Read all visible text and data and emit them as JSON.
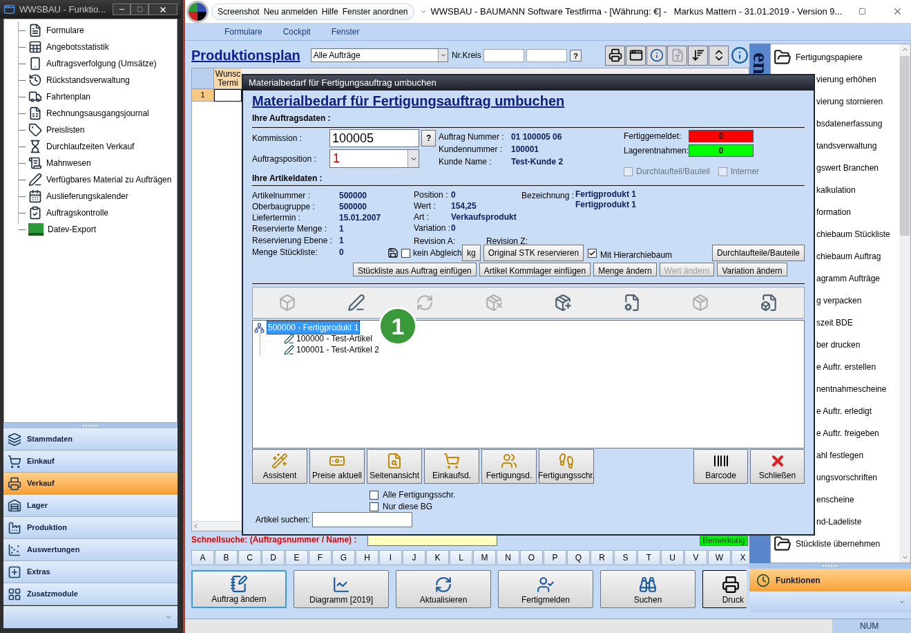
{
  "left_window": {
    "title": "WWSBAU - Funktio...",
    "tree": [
      {
        "label": "Formulare"
      },
      {
        "label": "Angebotsstatistik"
      },
      {
        "label": "Auftragsverfolgung (Umsätze)"
      },
      {
        "label": "Rückstandsverwaltung"
      },
      {
        "label": "Fahrtenplan"
      },
      {
        "label": "Rechnungsausgangsjournal"
      },
      {
        "label": "Preislisten"
      },
      {
        "label": "Durchlaufzeiten Verkauf"
      },
      {
        "label": "Mahnwesen"
      },
      {
        "label": "Verfügbares Material zu Aufträgen"
      },
      {
        "label": "Auslieferungskalender"
      },
      {
        "label": "Auftragskontrolle"
      },
      {
        "label": "Datev-Export"
      }
    ],
    "nav": [
      {
        "label": "Stammdaten",
        "selected": false
      },
      {
        "label": "Einkauf",
        "selected": false
      },
      {
        "label": "Verkauf",
        "selected": true
      },
      {
        "label": "Lager",
        "selected": false
      },
      {
        "label": "Produktion",
        "selected": false
      },
      {
        "label": "Auswertungen",
        "selected": false
      },
      {
        "label": "Extras",
        "selected": false
      },
      {
        "label": "Zusatzmodule",
        "selected": false
      }
    ]
  },
  "main_window": {
    "quick_menu": [
      "Screenshot",
      "Neu anmelden",
      "Hilfe",
      "Fenster anordnen"
    ],
    "title": "WWSBAU - BAUMANN Software Testfirma - [Währung: €] -   Markus Mattern - 31.01.2019 - Version 9...",
    "menu": [
      "Formulare",
      "Cockpit",
      "Fenster"
    ]
  },
  "plan": {
    "title": "Produktionsplan",
    "filter": "Alle Aufträge",
    "nr_kreis_label": "Nr.Kreis",
    "help": "?",
    "columns": [
      "Wunsc\nTermi"
    ],
    "rows": [
      {
        "number": "1",
        "selected": true
      }
    ],
    "quick_search_label": "Schnellsuche: (Auftragsnummer / Name) :",
    "remark": "Bemerkung",
    "letters": [
      "A",
      "B",
      "C",
      "D",
      "E",
      "F",
      "G",
      "H",
      "I",
      "J",
      "K",
      "L",
      "M",
      "N",
      "O",
      "P",
      "Q",
      "R",
      "S",
      "T",
      "U",
      "V",
      "W",
      "X"
    ],
    "actions": [
      {
        "label": "Auftrag ändern",
        "selected": true,
        "kind": "full"
      },
      {
        "label": "Diagramm [2019]",
        "selected": false,
        "kind": "full"
      },
      {
        "label": "Aktualisieren",
        "selected": false,
        "kind": "full"
      },
      {
        "label": "Fertigmelden",
        "selected": false,
        "kind": "full"
      },
      {
        "label": "Suchen",
        "selected": false,
        "kind": "full"
      },
      {
        "label": "Druck",
        "selected": false,
        "kind": "partial"
      }
    ]
  },
  "right_panel": {
    "caption": "en",
    "footer": "Funktionen",
    "items": [
      {
        "label": "Fertigungspapiere",
        "kind": "full"
      },
      {
        "label": "vierung erhöhen",
        "kind": "partial"
      },
      {
        "label": "vierung stornieren",
        "kind": "partial"
      },
      {
        "label": "bsdatenerfassung",
        "kind": "partial"
      },
      {
        "label": "tandsverwaltung",
        "kind": "partial"
      },
      {
        "label": "gswert Branchen",
        "kind": "partial"
      },
      {
        "label": "kalkulation",
        "kind": "partial"
      },
      {
        "label": "formation",
        "kind": "partial"
      },
      {
        "label": "chiebaum Stückliste",
        "kind": "partial"
      },
      {
        "label": "chiebaum Auftrag",
        "kind": "partial"
      },
      {
        "label": "agramm Aufträge",
        "kind": "partial"
      },
      {
        "label": "g verpacken",
        "kind": "partial"
      },
      {
        "label": "szeit BDE",
        "kind": "partial"
      },
      {
        "label": "ber drucken",
        "kind": "partial"
      },
      {
        "label": "e Auftr. erstellen",
        "kind": "partial"
      },
      {
        "label": "nentnahmescheine",
        "kind": "partial"
      },
      {
        "label": "e Auftr. erledigt",
        "kind": "partial"
      },
      {
        "label": "e Auftr. freigeben",
        "kind": "partial"
      },
      {
        "label": "ahl festlegen",
        "kind": "partial"
      },
      {
        "label": "ungsvorschriften",
        "kind": "partial"
      },
      {
        "label": "enscheine",
        "kind": "partial"
      },
      {
        "label": "nd-Ladeliste",
        "kind": "partial"
      },
      {
        "label": "Stückliste übernehmen",
        "kind": "full"
      }
    ]
  },
  "status_bar": {
    "num": "NUM"
  },
  "dialog": {
    "title": "Materialbedarf für Fertigungsauftrag umbuchen",
    "heading": "Materialbedarf für Fertigungsauftrag umbuchen",
    "order_section": "Ihre Auftragsdaten :",
    "commission": {
      "label": "Kommission :",
      "value": "100005",
      "help": "?"
    },
    "position": {
      "label": "Auftragsposition :",
      "value": "1"
    },
    "order_info": [
      {
        "label": "Auftrag Nummer :",
        "value": "01 100005 06"
      },
      {
        "label": "Kundennummer :",
        "value": "100001"
      },
      {
        "label": "Kunde Name :",
        "value": "Test-Kunde 2"
      }
    ],
    "counters": [
      {
        "label": "Fertiggemeldet:",
        "value": "0",
        "color": "#ff0000"
      },
      {
        "label": "Lagerentnahmen:",
        "value": "0",
        "color": "#00ff00"
      }
    ],
    "flags": [
      {
        "label": "Durchlaufteil/Bauteil",
        "checked": false,
        "disabled": true
      },
      {
        "label": "Interner",
        "checked": false,
        "disabled": true
      }
    ],
    "article_section": "Ihre Artikeldaten :",
    "article_left": [
      {
        "label": "Artikelnummer :",
        "value": "500000"
      },
      {
        "label": "Oberbaugruppe :",
        "value": "500000"
      },
      {
        "label": "Liefertermin :",
        "value": "15.01.2007"
      },
      {
        "label": "Reservierte Menge :",
        "value": "1"
      },
      {
        "label": "Reservierung Ebene :",
        "value": "1"
      },
      {
        "label": "Menge Stückliste:",
        "value": "0"
      }
    ],
    "article_mid": [
      {
        "label": "Position :",
        "value": "0"
      },
      {
        "label": "Wert :",
        "value": "154,25"
      },
      {
        "label": "Art :",
        "value": "Verkaufsprodukt"
      },
      {
        "label": "Variation :",
        "value": "0"
      }
    ],
    "designation": {
      "label": "Bezeichnung :",
      "lines": [
        "Fertigprodukt 1",
        "Fertigprodukt 1"
      ]
    },
    "revision_a": "Revision A:",
    "revision_z": "Revision Z:",
    "no_sync": {
      "label": "kein Abgleich",
      "checked": false
    },
    "unit_button": "kg",
    "reserve_button": "Original STK reservieren",
    "hierarchy": {
      "label": "Mit Hierarchiebaum",
      "checked": true
    },
    "parts_button": "Durchlaufteile/Bauteile",
    "row_buttons": [
      {
        "label": "Stückliste aus Auftrag einfügen",
        "disabled": false
      },
      {
        "label": "Artikel Kommlager einfügen",
        "disabled": false
      },
      {
        "label": "Menge ändern",
        "disabled": false
      },
      {
        "label": "Wert ändern",
        "disabled": true
      },
      {
        "label": "Variation ändern",
        "disabled": false
      }
    ],
    "toolbar": [
      {
        "disabled": true
      },
      {
        "disabled": false
      },
      {
        "disabled": true
      },
      {
        "disabled": true
      },
      {
        "disabled": false
      },
      {
        "disabled": false
      },
      {
        "disabled": true
      },
      {
        "disabled": false
      }
    ],
    "tree": [
      {
        "label": "500000 - Fertigprodukt 1",
        "selected": true,
        "children": [
          {
            "label": "100000 - Test-Artikel",
            "selected": false
          },
          {
            "label": "100001 - Test-Artikel 2",
            "selected": false
          }
        ]
      }
    ],
    "badge": "1",
    "buttons_left": [
      "Assistent",
      "Preise aktuell",
      "Seitenansicht",
      "Einkaufsd.",
      "Fertigungsd.",
      "Fertigungsschr."
    ],
    "buttons_right": [
      "Barcode",
      "Schließen"
    ],
    "options": [
      {
        "label": "Alle Fertigungsschr.",
        "checked": false
      },
      {
        "label": "Nur diese BG",
        "checked": false
      }
    ],
    "search_label": "Artikel suchen:"
  }
}
